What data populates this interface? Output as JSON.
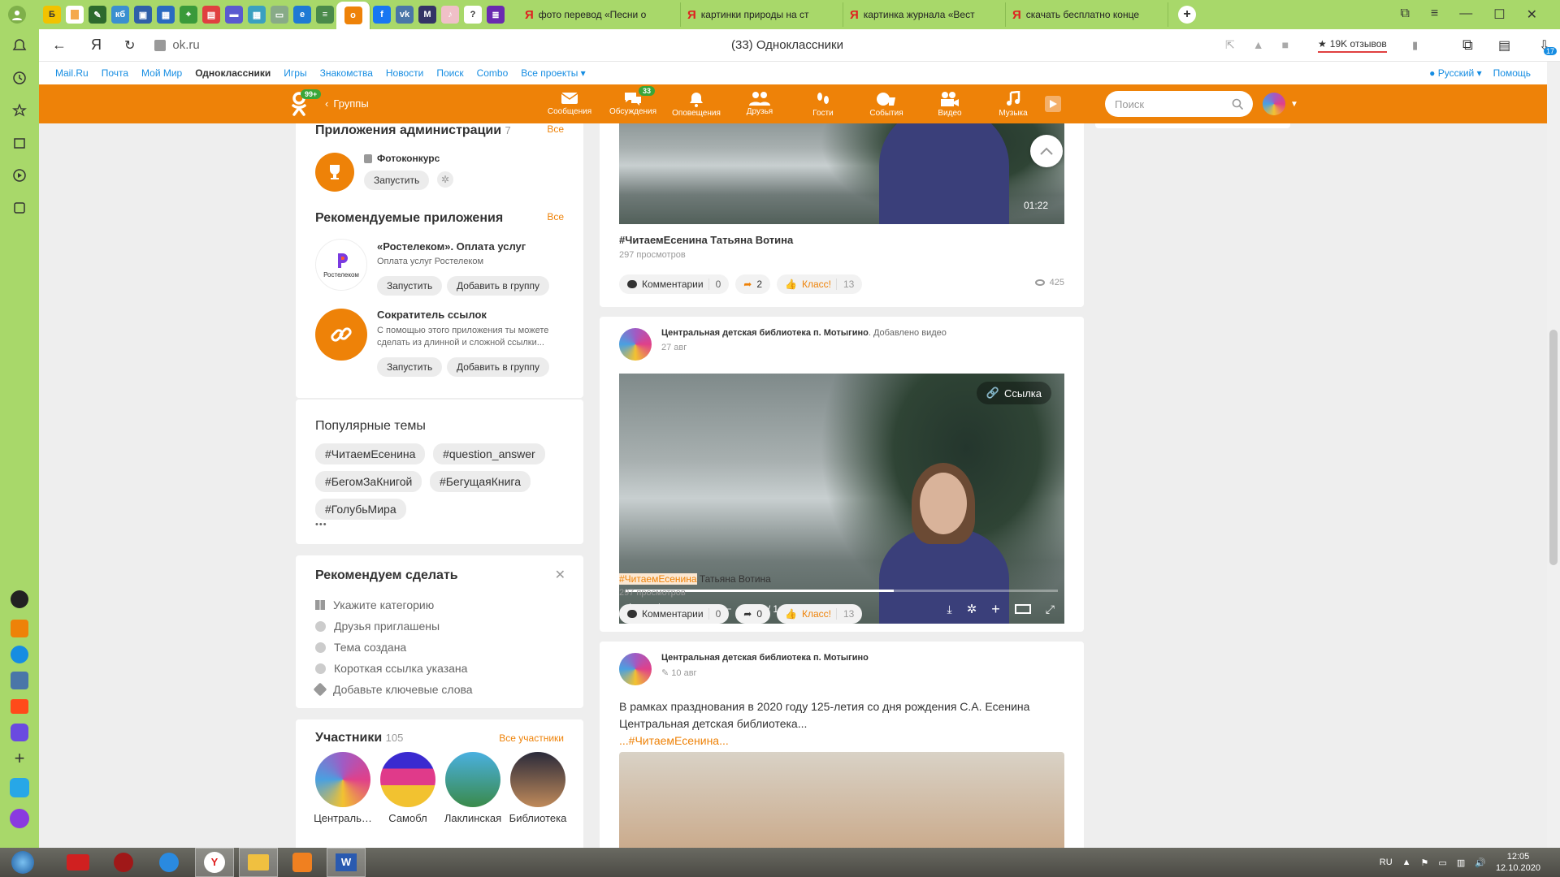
{
  "browser": {
    "tabs": [
      {
        "title": "фото перевод «Песни о"
      },
      {
        "title": "картинки природы на ст"
      },
      {
        "title": "картинка журнала «Вест"
      },
      {
        "title": "скачать бесплатно конце"
      }
    ],
    "address": "ok.ru",
    "page_title": "(33) Одноклассники",
    "reviews": "19K отзывов",
    "notif_badge": "17"
  },
  "mailru_bar": {
    "links": [
      "Mail.Ru",
      "Почта",
      "Мой Мир",
      "Одноклассники",
      "Игры",
      "Знакомства",
      "Новости",
      "Поиск",
      "Combo",
      "Все проекты"
    ],
    "language": "Русский",
    "help": "Помощь"
  },
  "ok_header": {
    "logo_badge": "99+",
    "back_label": "Группы",
    "nav": [
      {
        "label": "Сообщения",
        "icon": "envelope-icon",
        "badge": ""
      },
      {
        "label": "Обсуждения",
        "icon": "chat-icon",
        "badge": "33"
      },
      {
        "label": "Оповещения",
        "icon": "bell-icon",
        "badge": ""
      },
      {
        "label": "Друзья",
        "icon": "friends-icon",
        "badge": ""
      },
      {
        "label": "Гости",
        "icon": "footprints-icon",
        "badge": ""
      },
      {
        "label": "События",
        "icon": "events-icon",
        "badge": ""
      },
      {
        "label": "Видео",
        "icon": "video-camera-icon",
        "badge": ""
      },
      {
        "label": "Музыка",
        "icon": "music-note-icon",
        "badge": ""
      }
    ],
    "search_placeholder": "Поиск"
  },
  "admin_apps": {
    "title": "Приложения администрации",
    "count": "7",
    "all": "Все",
    "app_name": "Фотоконкурс",
    "launch": "Запустить"
  },
  "recommended_apps": {
    "title": "Рекомендуемые приложения",
    "all": "Все",
    "apps": [
      {
        "name": "«Ростелеком». Оплата услуг",
        "desc": "Оплата услуг Ростелеком",
        "logo_text": "Ростелеком",
        "launch": "Запустить",
        "add": "Добавить в группу"
      },
      {
        "name": "Сократитель ссылок",
        "desc": "С помощью этого приложения ты можете сделать из длинной и сложной ссылки...",
        "logo_text": "",
        "launch": "Запустить",
        "add": "Добавить в группу"
      }
    ]
  },
  "popular_topics": {
    "title": "Популярные темы",
    "tags": [
      "#ЧитаемЕсенина",
      "#question_answer",
      "#БегомЗаКнигой",
      "#БегущаяКнига",
      "#ГолубьМира"
    ],
    "more": "•••"
  },
  "recommend_todo": {
    "title": "Рекомендуем сделать",
    "items": [
      {
        "text": "Укажите категорию",
        "done": false,
        "icon": "grid-icon"
      },
      {
        "text": "Друзья приглашены",
        "done": true,
        "icon": "check-circle-icon"
      },
      {
        "text": "Тема создана",
        "done": true,
        "icon": "check-circle-icon"
      },
      {
        "text": "Короткая ссылка указана",
        "done": true,
        "icon": "check-circle-icon"
      },
      {
        "text": "Добавьте ключевые слова",
        "done": false,
        "icon": "tag-icon"
      }
    ]
  },
  "participants": {
    "title": "Участники",
    "count": "105",
    "all": "Все участники",
    "list": [
      {
        "name": "Централь…"
      },
      {
        "name": "Самобл"
      },
      {
        "name": "Лаклинская"
      },
      {
        "name": "Библиотека"
      }
    ]
  },
  "feed": [
    {
      "video_time": "01:22",
      "caption": "#ЧитаемЕсенина Татьяна Вотина",
      "views": "297 просмотров",
      "comments_label": "Комментарии",
      "comments": "0",
      "shares": "2",
      "klass_label": "Класс!",
      "klass": "13",
      "eye_count": "425"
    },
    {
      "author": "Центральная детская библиотека п. Мотыгино",
      "action": ". Добавлено видео",
      "date": "27 авг",
      "link_label": "Ссылка",
      "player_time": "0:52 / 1:22",
      "progress": 0.62,
      "volume": 0.12,
      "caption_tag": "#ЧитаемЕсенина",
      "caption_rest": " Татьяна Вотина",
      "views": "297 просмотров",
      "comments_label": "Комментарии",
      "comments": "0",
      "shares": "0",
      "klass_label": "Класс!",
      "klass": "13"
    },
    {
      "author": "Центральная детская библиотека п. Мотыгино",
      "date": "10 авг",
      "text1": "В рамках празднования в 2020 году 125-летия со дня рождения С.А. Есенина",
      "text2": "Центральная детская библиотека...",
      "tag_prefix": "...",
      "tag": "#ЧитаемЕсенина",
      "tag_suffix": "..."
    }
  ],
  "taskbar": {
    "lang": "RU",
    "time": "12:05",
    "date": "12.10.2020"
  },
  "colors": {
    "ok_orange": "#ee8208",
    "browser_green": "#a8d86a",
    "link_blue": "#168de2"
  }
}
